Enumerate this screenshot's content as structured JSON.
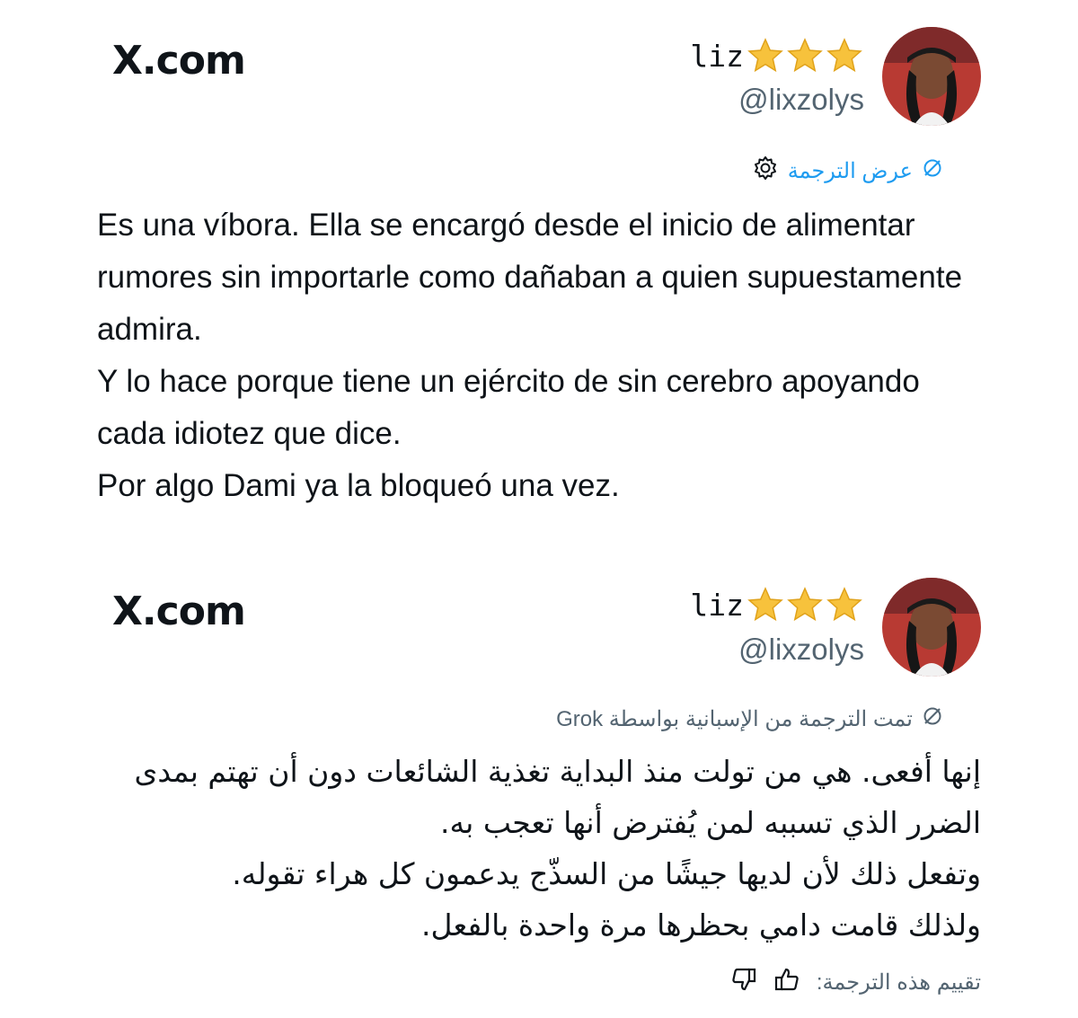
{
  "cards": [
    {
      "site": "X.com",
      "author": {
        "name": "liz",
        "handle": "@lixzolys",
        "badges": [
          "star-icon",
          "star-icon",
          "star-icon"
        ]
      },
      "translation_link": "عرض الترجمة",
      "body": [
        "Es una víbora. Ella se encargó desde el inicio de alimentar rumores sin importarle como dañaban a quien supuestamente admira.",
        "Y lo hace porque tiene un ejército de sin cerebro apoyando cada idiotez que dice.",
        "Por algo Dami ya la bloqueó una vez."
      ]
    },
    {
      "site": "X.com",
      "author": {
        "name": "liz",
        "handle": "@lixzolys",
        "badges": [
          "star-icon",
          "star-icon",
          "star-icon"
        ]
      },
      "translation_note": "تمت الترجمة من الإسبانية بواسطة Grok",
      "body": [
        "إنها أفعى. هي من تولت منذ البداية تغذية الشائعات دون أن تهتم بمدى الضرر الذي تسببه لمن يُفترض أنها تعجب به.",
        "وتفعل ذلك لأن لديها جيشًا من السذّج يدعمون كل هراء تقوله.",
        "ولذلك قامت دامي بحظرها مرة واحدة بالفعل."
      ],
      "rating_label": "تقييم هذه الترجمة:"
    }
  ],
  "colors": {
    "link_blue": "#1d9bf0",
    "secondary_gray": "#536471",
    "text": "#0f1419",
    "star_gold": "#f5c518"
  }
}
